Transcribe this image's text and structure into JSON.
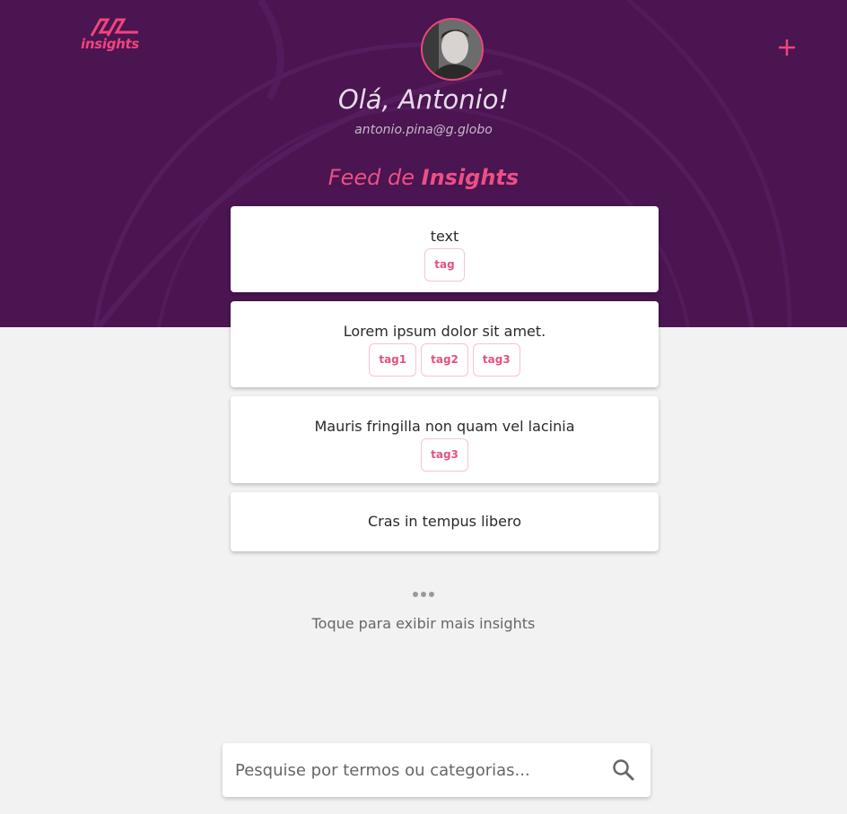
{
  "header": {
    "logo_text": "insights",
    "greeting": "Olá, Antonio!",
    "email": "antonio.pina@g.globo",
    "feed_title_prefix": "Feed de",
    "feed_title_bold": "Insights"
  },
  "feed": {
    "items": [
      {
        "text": "text",
        "tags": [
          "tag"
        ]
      },
      {
        "text": "Lorem ipsum dolor sit amet.",
        "tags": [
          "tag1",
          "tag2",
          "tag3"
        ]
      },
      {
        "text": "Mauris fringilla non quam vel lacinia",
        "tags": [
          "tag3"
        ]
      },
      {
        "text": "Cras in tempus libero",
        "tags": []
      }
    ],
    "load_more_label": "Toque para exibir mais insights"
  },
  "search": {
    "placeholder": "Pesquise por termos ou categorias..."
  },
  "icons": {
    "logo": "insights-logo-icon",
    "add": "plus-icon",
    "more": "ellipsis-icon",
    "search": "search-icon"
  },
  "colors": {
    "header_bg": "#4a1550",
    "accent": "#f0457a",
    "page_bg": "#f2f2f2"
  }
}
